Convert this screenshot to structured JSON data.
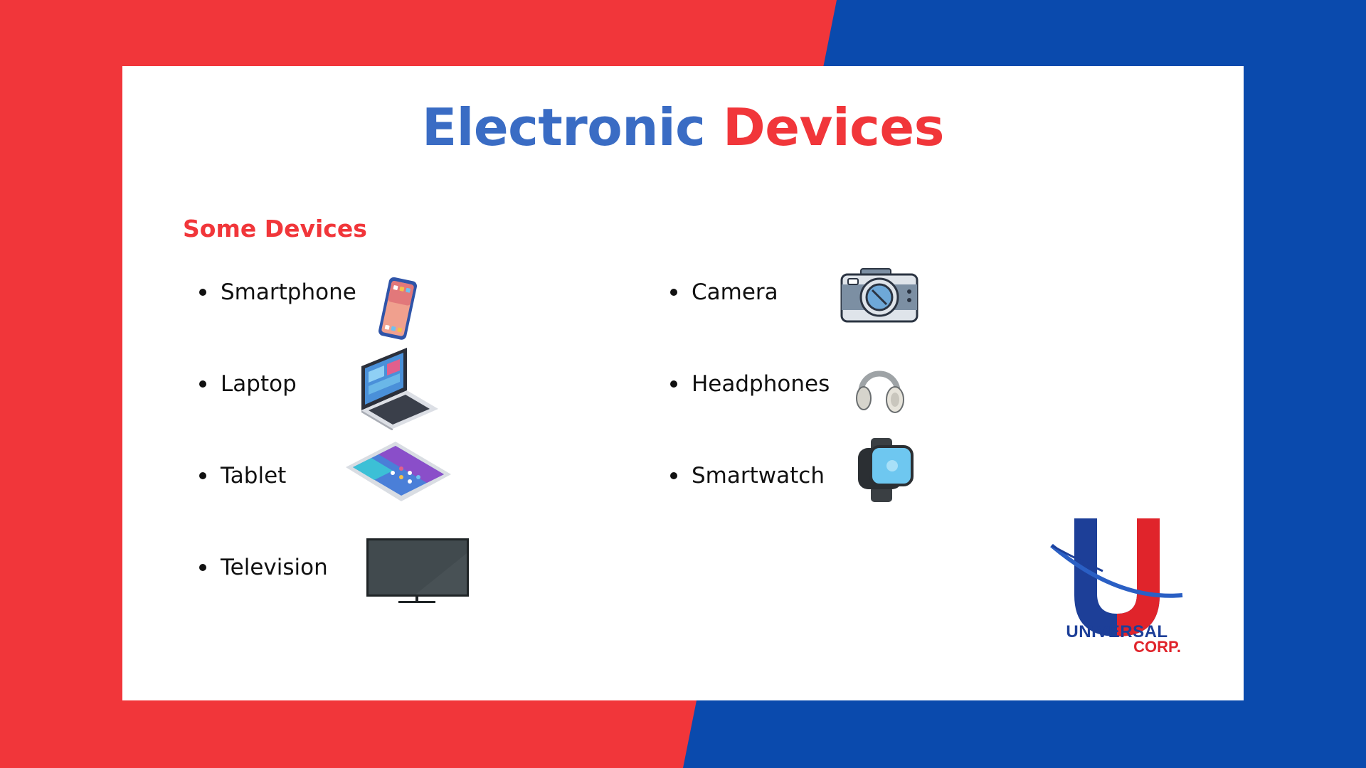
{
  "colors": {
    "red": "#f1363a",
    "blue": "#0a4aad",
    "title_blue": "#3a6cc4",
    "card": "#ffffff"
  },
  "title": {
    "word1": "Electronic",
    "word2": "Devices"
  },
  "subtitle": "Some Devices",
  "devices_left": [
    {
      "label": "Smartphone",
      "icon": "smartphone-icon"
    },
    {
      "label": "Laptop",
      "icon": "laptop-icon"
    },
    {
      "label": "Tablet",
      "icon": "tablet-icon"
    },
    {
      "label": "Television",
      "icon": "television-icon"
    }
  ],
  "devices_right": [
    {
      "label": "Camera",
      "icon": "camera-icon"
    },
    {
      "label": "Headphones",
      "icon": "headphones-icon"
    },
    {
      "label": "Smartwatch",
      "icon": "smartwatch-icon"
    }
  ],
  "logo": {
    "line1": "UNIVERSAL",
    "line2": "CORP."
  }
}
